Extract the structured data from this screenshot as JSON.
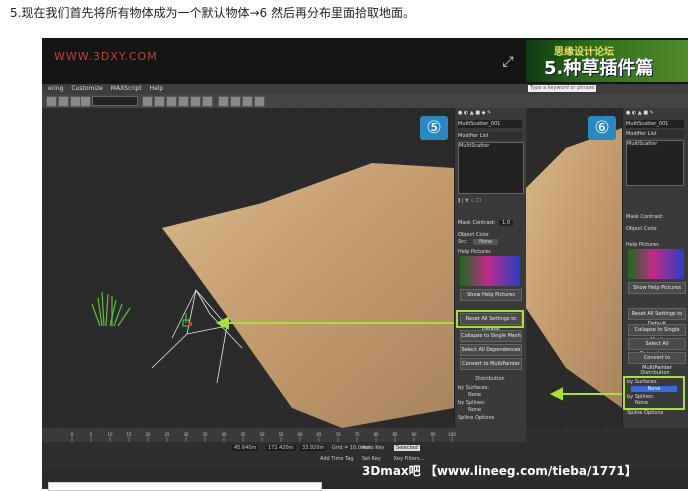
{
  "caption": "5.现在我们首先将所有物体成为一个默认物体→6 然后再分布里面拾取地面。",
  "watermark": "WWW.3DXY.COM",
  "banner": {
    "line1": "思缘设计论坛",
    "line2": "5.种草插件篇"
  },
  "badges": {
    "left": "⑤",
    "right": "⑥"
  },
  "menubar": [
    "ering",
    "Customize",
    "MAXScript",
    "Help"
  ],
  "search_placeholder": "Type a keyword or phrase",
  "panel": {
    "object_name": "MultiScatter_001",
    "modifier_list": "Modifier List",
    "stack_item": "MultiScatter",
    "mask_contrast_label": "Mask Contrast:",
    "mask_contrast_value": "1.0",
    "object_color_label": "Object Color",
    "object_color_sub": "Src:",
    "object_color_value": "None",
    "help_pictures_label": "Help Pictures",
    "show_help_pictures": "Show Help Pictures",
    "reset_button": "Reset All Settings to Default",
    "collapse_button": "Collapse to Single Mesh",
    "select_deps_button": "Select All Dependences",
    "convert_button": "Convert to MultiPainter",
    "distribution_label": "Distribution",
    "by_surfaces": "by Surfaces:",
    "by_splines": "by Splines:",
    "none_value": "None",
    "spline_options": "Spline Options",
    "thickness_label": "Thickness:",
    "object_distance": "Object Distance",
    "no_regular": "(No Regular Pattern)",
    "use_scale": "Use Scale Multi > 1.0"
  },
  "status": {
    "x_value": "45.640m",
    "y_value": "172.420m",
    "z_value": "33.920m",
    "grid": "Grid = 10.0mm",
    "autokey": "Auto Key",
    "selected": "Selected",
    "setkey": "Set Key",
    "keyfilters": "Key Filters...",
    "addtimetag": "Add Time Tag"
  },
  "timeline_ticks": [
    "0",
    "5",
    "10",
    "15",
    "20",
    "25",
    "30",
    "35",
    "40",
    "45",
    "50",
    "55",
    "60",
    "65",
    "70",
    "75",
    "80",
    "85",
    "90",
    "95",
    "100"
  ],
  "bottom_text": "3Dmax吧 【www.lineeg.com/tieba/1771】",
  "colors": {
    "highlight": "#a6e23a",
    "ground": "#c9a27a",
    "badge": "#2a8ac0"
  }
}
